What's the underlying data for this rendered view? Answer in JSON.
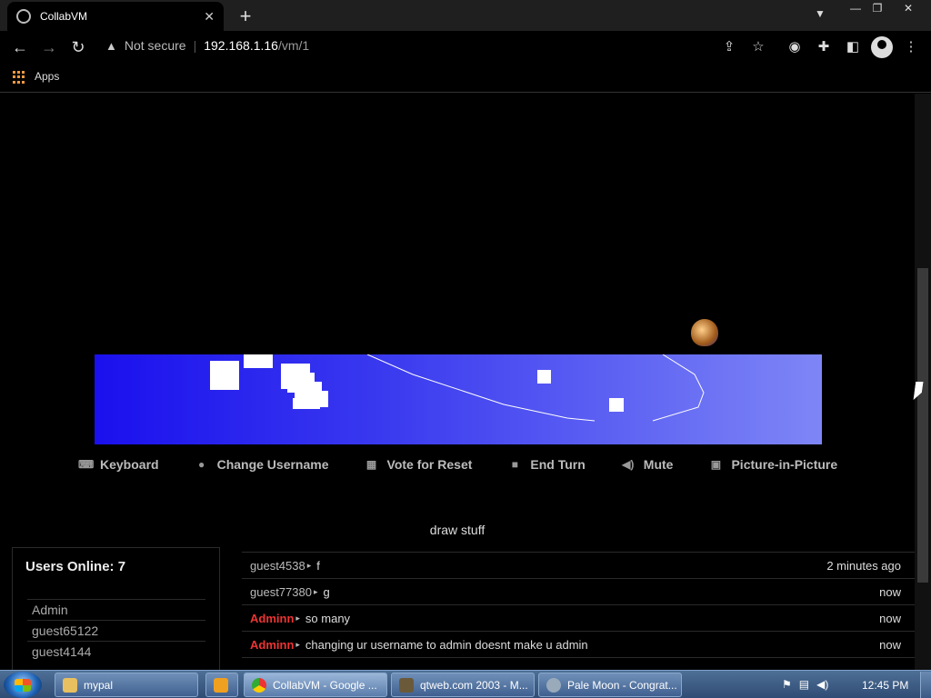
{
  "browser": {
    "tab_title": "CollabVM",
    "security_label": "Not secure",
    "url_host": "192.168.1.16",
    "url_path": "/vm/1",
    "bookmark_apps": "Apps"
  },
  "vm": {
    "actions": [
      {
        "label": "Keyboard",
        "icon": "keyboard-icon"
      },
      {
        "label": "Change Username",
        "icon": "user-icon"
      },
      {
        "label": "Vote for Reset",
        "icon": "vote-icon"
      },
      {
        "label": "End Turn",
        "icon": "stop-icon"
      },
      {
        "label": "Mute",
        "icon": "volume-icon"
      },
      {
        "label": "Picture-in-Picture",
        "icon": "picture-in-picture-icon"
      }
    ],
    "status": "draw stuff"
  },
  "users": {
    "title": "Users Online: 7",
    "list": [
      "Admin",
      "guest65122",
      "guest4144"
    ]
  },
  "chat": {
    "messages": [
      {
        "name": "guest4538",
        "text": "f",
        "time": "2 minutes ago",
        "admin": false
      },
      {
        "name": "guest77380",
        "text": "g",
        "time": "now",
        "admin": false
      },
      {
        "name": "Adminn",
        "text": "so many",
        "time": "now",
        "admin": true
      },
      {
        "name": "Adminn",
        "text": "changing ur username to admin doesnt make u admin",
        "time": "now",
        "admin": true
      }
    ]
  },
  "taskbar": {
    "items": [
      {
        "label": "mypal",
        "icon": "folder-icon"
      },
      {
        "label": "",
        "icon": "media-player-icon"
      },
      {
        "label": "CollabVM - Google ...",
        "icon": "chrome-icon"
      },
      {
        "label": "qtweb.com 2003 - M...",
        "icon": "browser-icon"
      },
      {
        "label": "Pale Moon - Congrat...",
        "icon": "pale-moon-icon"
      }
    ],
    "clock": "12:45 PM"
  },
  "colors": {
    "admin_name": "#ee3333",
    "vm_gradient_start": "#1a10ee",
    "vm_gradient_end": "#7e86f6"
  }
}
